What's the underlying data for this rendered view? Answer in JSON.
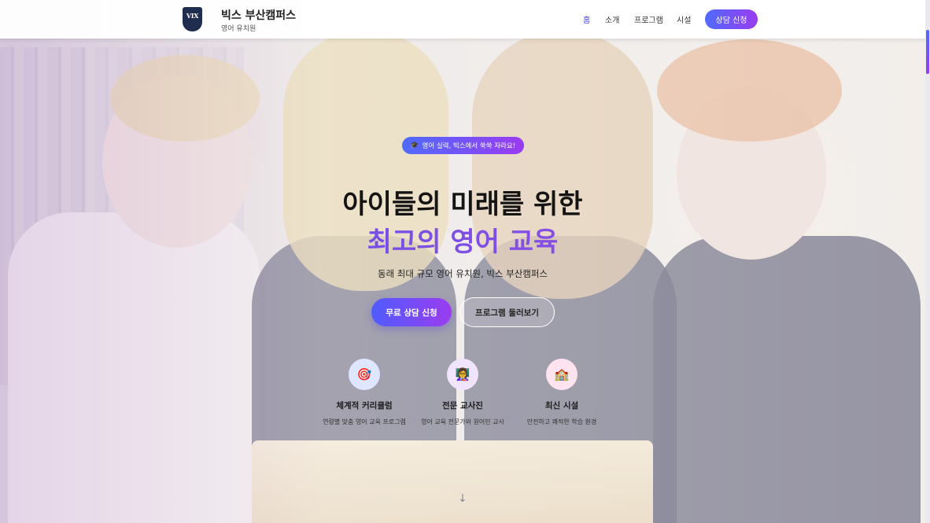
{
  "header": {
    "logo_text": "VIX",
    "brand_title": "빅스 부산캠퍼스",
    "brand_subtitle": "영어 유치원",
    "nav": [
      {
        "label": "홈",
        "active": true
      },
      {
        "label": "소개",
        "active": false
      },
      {
        "label": "프로그램",
        "active": false
      },
      {
        "label": "시설",
        "active": false
      }
    ],
    "cta_label": "상담 신청"
  },
  "hero": {
    "badge_icon": "graduation-cap-icon",
    "badge_label": "영어 실력, 빅스에서 쑥쑥 자라요!",
    "headline_line1": "아이들의 미래를 위한",
    "headline_line2": "최고의 영어 교육",
    "subtitle": "동래 최대 규모 영어 유치원, 빅스 부산캠퍼스",
    "primary_button": "무료 상담 신청",
    "secondary_button": "프로그램 둘러보기"
  },
  "features": [
    {
      "icon": "target-icon",
      "glyph": "🎯",
      "title": "체계적 커리큘럼",
      "desc": "연령별 맞춤 영어 교육 프로그램",
      "bg": "#dfe6ff"
    },
    {
      "icon": "teacher-icon",
      "glyph": "👩‍🏫",
      "title": "전문 교사진",
      "desc": "영어 교육 전문가와 원어민 교사",
      "bg": "#f1e4ff"
    },
    {
      "icon": "school-icon",
      "glyph": "🏫",
      "title": "최신 시설",
      "desc": "안전하고 쾌적한 학습 환경",
      "bg": "#ffe3ef"
    }
  ],
  "scroll_indicator": "↓",
  "colors": {
    "accent_start": "#4f6bff",
    "accent_end": "#9a3bf0",
    "active_nav": "#3c3fe0"
  }
}
